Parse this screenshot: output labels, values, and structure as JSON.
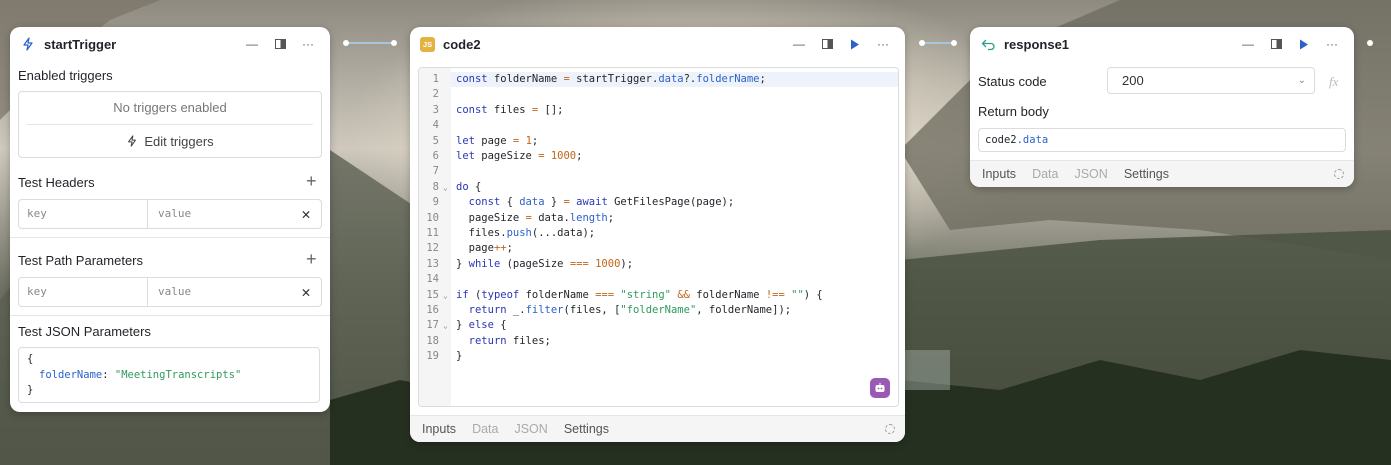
{
  "start_trigger": {
    "title": "startTrigger",
    "enabled_triggers_label": "Enabled triggers",
    "no_triggers_text": "No triggers enabled",
    "edit_triggers_label": "Edit triggers",
    "test_headers_label": "Test Headers",
    "test_path_params_label": "Test Path Parameters",
    "test_json_params_label": "Test JSON Parameters",
    "key_placeholder": "key",
    "value_placeholder": "value",
    "json_open": "{",
    "json_key": "folderName",
    "json_colon": ":",
    "json_value": "\"MeetingTranscripts\"",
    "json_close": "}"
  },
  "code2": {
    "title": "code2",
    "badge": "JS",
    "line_numbers": [
      "1",
      "2",
      "3",
      "4",
      "5",
      "6",
      "7",
      "8",
      "9",
      "10",
      "11",
      "12",
      "13",
      "14",
      "15",
      "16",
      "17",
      "18",
      "19"
    ],
    "tabs": [
      "Inputs",
      "Data",
      "JSON",
      "Settings"
    ]
  },
  "response1": {
    "title": "response1",
    "status_code_label": "Status code",
    "status_code_value": "200",
    "fx_label": "fx",
    "return_body_label": "Return body",
    "return_body_prefix": "code2",
    "return_body_suffix": ".data",
    "tabs": [
      "Inputs",
      "Data",
      "JSON",
      "Settings"
    ]
  },
  "colors": {
    "accent": "#2b62c9",
    "js_badge": "#e3b341",
    "bot_icon": "#9b59b6",
    "connector": "#a9c4dd"
  }
}
